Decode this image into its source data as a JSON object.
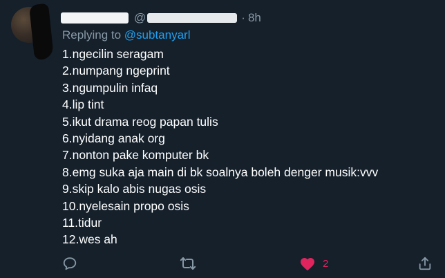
{
  "tweet": {
    "at_symbol": "@",
    "separator": "·",
    "time": "8h",
    "replying_prefix": "Replying to",
    "replying_handle": "@subtanyarl",
    "lines": [
      "1.ngecilin seragam",
      "2.numpang ngeprint",
      "3.ngumpulin infaq",
      "4.lip tint",
      "5.ikut drama reog papan tulis",
      "6.nyidang anak org",
      "7.nonton pake komputer bk",
      "8.emg suka aja main di bk soalnya boleh denger musik:vvv",
      "9.skip kalo abis nugas osis",
      "10.nyelesain propo osis",
      "11.tidur",
      "12.wes ah"
    ]
  },
  "actions": {
    "like_count": "2",
    "icons": [
      "reply-icon",
      "retweet-icon",
      "heart-icon",
      "share-icon"
    ],
    "like_color": "#e0245e",
    "icon_color": "#8899a6"
  },
  "colors": {
    "background": "#15202b",
    "mention": "#1da1f2",
    "muted": "#8899a6"
  }
}
